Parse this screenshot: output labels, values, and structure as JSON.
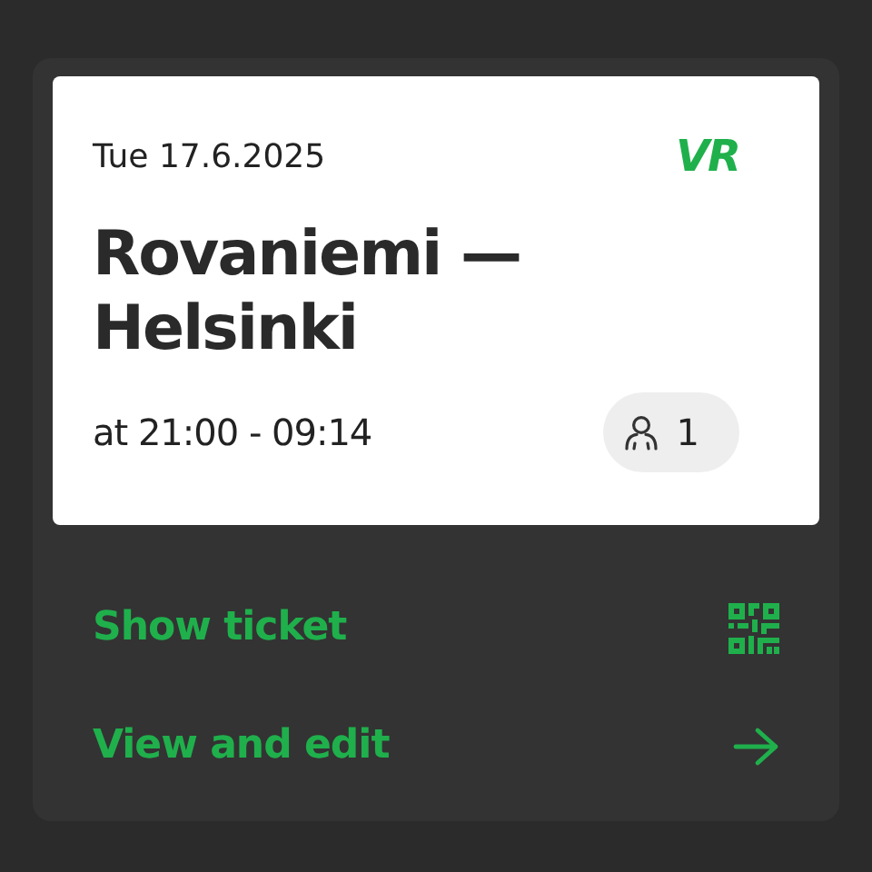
{
  "ticket": {
    "date": "Tue 17.6.2025",
    "logo": "VR",
    "route": "Rovaniemi — Helsinki",
    "time": "at 21:00 - 09:14",
    "passengers": "1"
  },
  "actions": [
    {
      "label": "Show ticket",
      "kind": "qr"
    },
    {
      "label": "View and edit",
      "kind": "arrow"
    }
  ]
}
